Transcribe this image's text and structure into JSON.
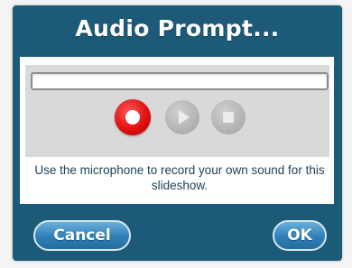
{
  "dialog": {
    "title": "Audio Prompt...",
    "message": "Use the microphone to record your own sound for this slideshow."
  },
  "controls": {
    "record_icon": "record-icon",
    "play_icon": "play-icon",
    "stop_icon": "stop-icon"
  },
  "buttons": {
    "cancel_label": "Cancel",
    "ok_label": "OK"
  },
  "progress": {
    "value_fraction": 0
  },
  "colors": {
    "dialog_frame": "#1c5a78",
    "record_red": "#e01010",
    "button_blue": "#2f7fb6",
    "message_text": "#1b3f57"
  }
}
